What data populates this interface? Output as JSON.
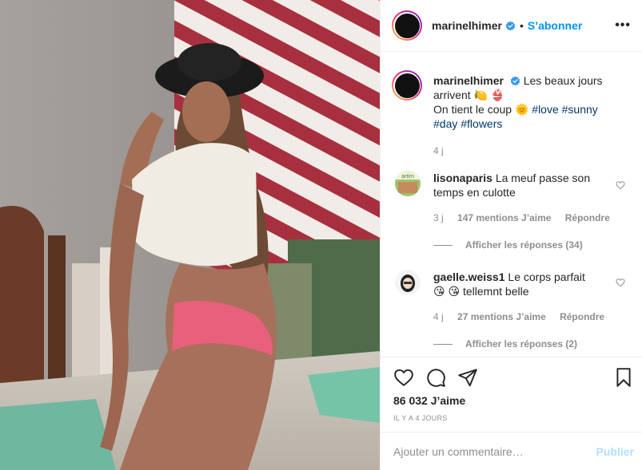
{
  "header": {
    "username": "marinelhimer",
    "dot": "•",
    "follow_label": "S’abonner",
    "more_label": "•••"
  },
  "caption": {
    "username": "marinelhimer",
    "text_line1": "Les beaux jours arrivent",
    "emoji1": "🍋",
    "emoji2": "👙",
    "text_line2": "On tient le coup",
    "emoji3": "🌞",
    "tags": [
      "#love",
      "#sunny",
      "#day",
      "#flowers"
    ],
    "time": "4 j"
  },
  "comments": [
    {
      "username": "lisonaparis",
      "text": "La meuf passe son temps en culotte",
      "time": "3 j",
      "likes": "147 mentions J’aime",
      "reply": "Répondre",
      "view_replies": "Afficher les réponses (34)"
    },
    {
      "username": "gaelle.weiss1",
      "text_a": "Le corps parfait",
      "emoji": "😘",
      "text_b": "tellemnt belle",
      "time": "4 j",
      "likes": "27 mentions J’aime",
      "reply": "Répondre",
      "view_replies": "Afficher les réponses (2)"
    }
  ],
  "actions": {
    "like_icon": "heart-icon",
    "comment_icon": "comment-icon",
    "share_icon": "paper-plane-icon",
    "save_icon": "bookmark-icon",
    "likes_count": "86 032 J’aime",
    "posted_ago": "IL Y A 4 JOURS"
  },
  "add_comment": {
    "placeholder": "Ajouter un commentaire…",
    "publish_label": "Publier"
  },
  "colors": {
    "accent": "#0095f6",
    "publish_disabled": "#b2dffc",
    "text": "#262626",
    "muted": "#8e8e8e"
  }
}
